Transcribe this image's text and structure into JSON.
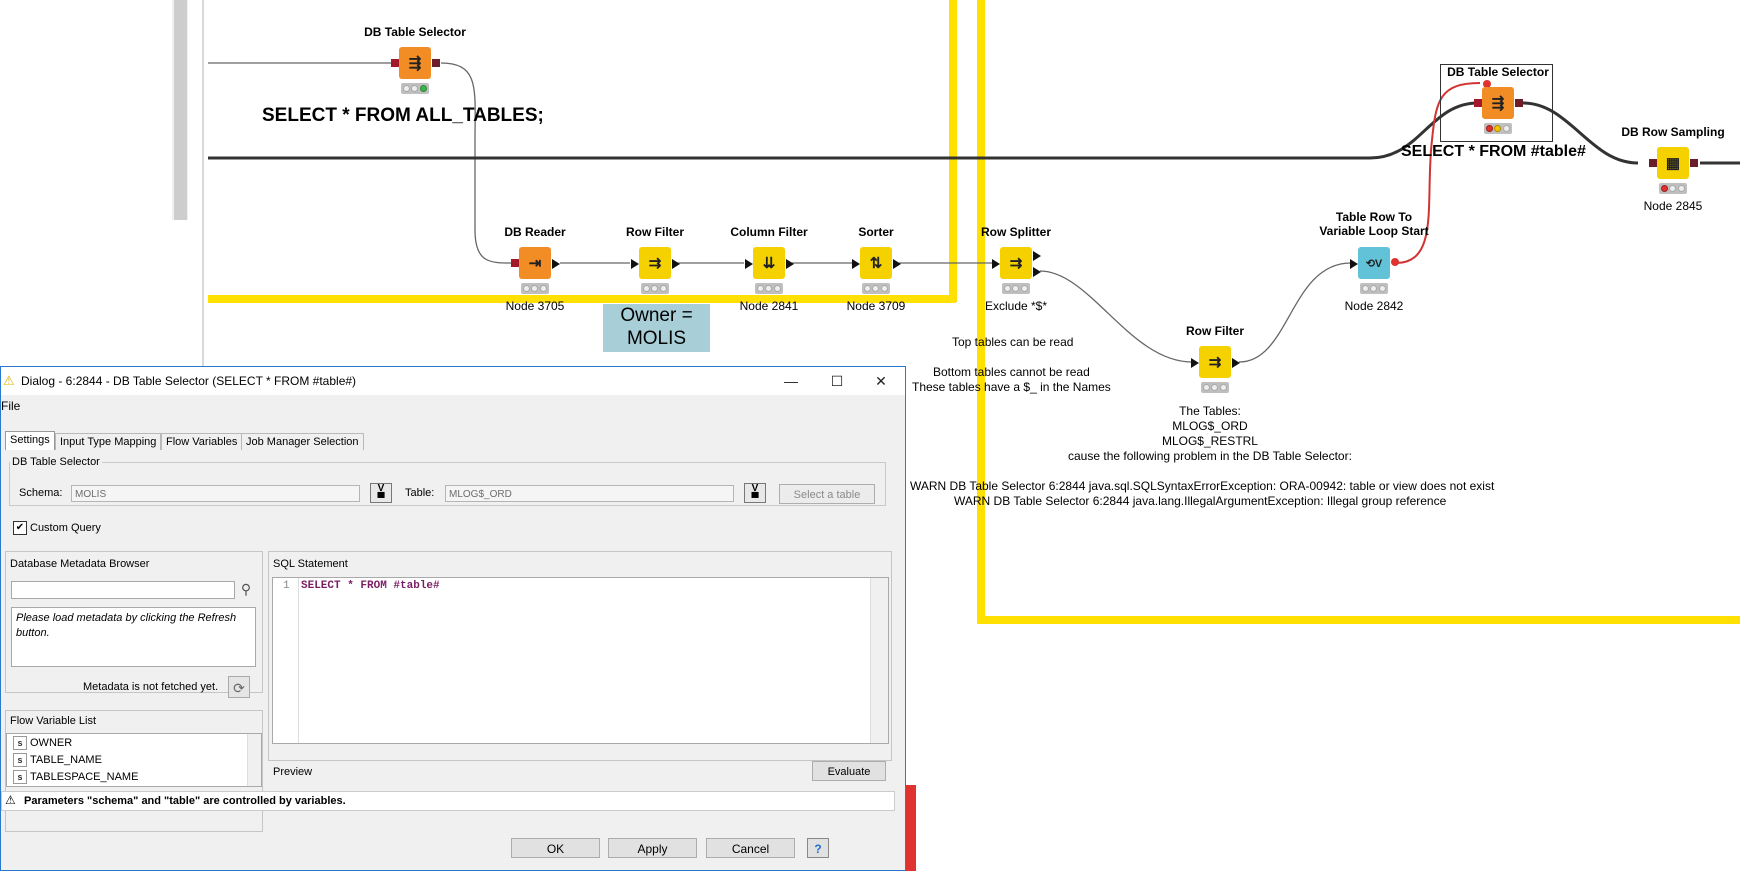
{
  "workflow": {
    "top_selector_label": "DB Table Selector",
    "top_sql_annotation": "SELECT * FROM ALL_TABLES;",
    "nodes": [
      {
        "label": "DB Reader",
        "sub": "Node 3705"
      },
      {
        "label": "Row Filter",
        "sub": ""
      },
      {
        "label": "Column Filter",
        "sub": "Node 2841"
      },
      {
        "label": "Sorter",
        "sub": "Node 3709"
      },
      {
        "label": "Row Splitter",
        "sub": "Exclude *$*"
      },
      {
        "label": "Row Filter",
        "sub": ""
      },
      {
        "label": "Table Row To\nVariable Loop Start",
        "sub": "Node 2842"
      },
      {
        "label": "DB Table Selector",
        "sub": ""
      },
      {
        "label": "DB Row Sampling",
        "sub": "Node 2845"
      }
    ],
    "owner_annotation_line1": "Owner =",
    "owner_annotation_line2": "MOLIS",
    "right_sql_annotation": "SELECT * FROM #table#",
    "top_tables_note": "Top tables can be read",
    "bottom_tables_note_1": "Bottom tables cannot be read",
    "bottom_tables_note_2": "These tables have a $_ in the Names",
    "tables_note": [
      "The Tables:",
      "MLOG$_ORD",
      "MLOG$_RESTRL",
      "cause the following problem in the DB Table Selector:"
    ],
    "warn_1": "WARN  DB Table Selector    6:2844     java.sql.SQLSyntaxErrorException: ORA-00942: table or view does not exist",
    "warn_2": "WARN  DB Table Selector    6:2844     java.lang.IllegalArgumentException: Illegal group reference",
    "colors": {
      "yellow_frame": "#ffe000",
      "node_orange": "#f28c24",
      "node_yellow": "#f6d100",
      "node_teal": "#62c3d8",
      "variable_wire": "#d03434"
    }
  },
  "dialog": {
    "title": "Dialog - 6:2844 - DB Table Selector (SELECT * FROM #table#)",
    "menu_file": "File",
    "tabs": [
      "Settings",
      "Input Type Mapping",
      "Flow Variables",
      "Job Manager Selection"
    ],
    "group_label": "DB Table Selector",
    "schema_label": "Schema:",
    "schema_value": "MOLIS",
    "table_label": "Table:",
    "table_value": "MLOG$_ORD",
    "select_table_button": "Select a table",
    "custom_query_label": "Custom Query",
    "metadata_browser_title": "Database Metadata Browser",
    "search_placeholder": "",
    "metadata_message": "Please load metadata by clicking the Refresh button.",
    "metadata_status": "Metadata is not fetched yet.",
    "flow_variable_list_title": "Flow Variable List",
    "flow_variables": [
      "OWNER",
      "TABLE_NAME",
      "TABLESPACE_NAME"
    ],
    "sql_statement_title": "SQL Statement",
    "sql_line_number": "1",
    "sql_text": "SELECT * FROM #table#",
    "preview_label": "Preview",
    "evaluate_button": "Evaluate",
    "warning_text": "Parameters \"schema\" and \"table\" are controlled by variables.",
    "ok_button": "OK",
    "apply_button": "Apply",
    "cancel_button": "Cancel",
    "help_button": "?"
  }
}
